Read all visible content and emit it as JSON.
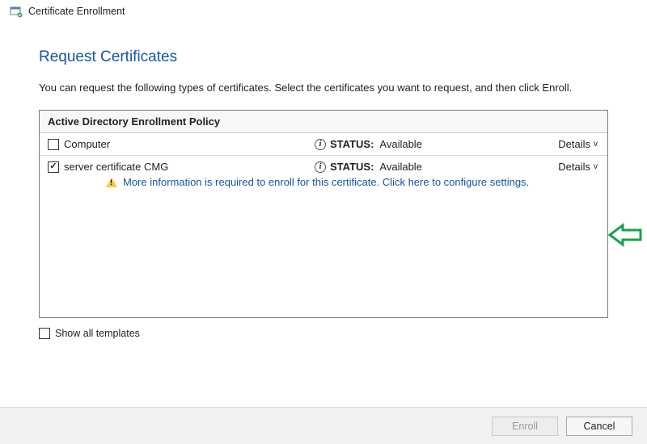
{
  "window": {
    "title": "Certificate Enrollment"
  },
  "page": {
    "heading": "Request Certificates",
    "intro": "You can request the following types of certificates. Select the certificates you want to request, and then click Enroll."
  },
  "policy": {
    "title": "Active Directory Enrollment Policy",
    "certificates": [
      {
        "name": "Computer",
        "checked": false,
        "status_label": "STATUS:",
        "status_value": "Available",
        "details_label": "Details",
        "warning": null
      },
      {
        "name": "server certificate CMG",
        "checked": true,
        "status_label": "STATUS:",
        "status_value": "Available",
        "details_label": "Details",
        "warning": "More information is required to enroll for this certificate. Click here to configure settings."
      }
    ]
  },
  "show_all": {
    "checked": false,
    "label": "Show all templates"
  },
  "footer": {
    "enroll": {
      "label": "Enroll",
      "enabled": false
    },
    "cancel": {
      "label": "Cancel",
      "enabled": true
    }
  },
  "info_glyph": "i",
  "chevron_glyph": "v"
}
